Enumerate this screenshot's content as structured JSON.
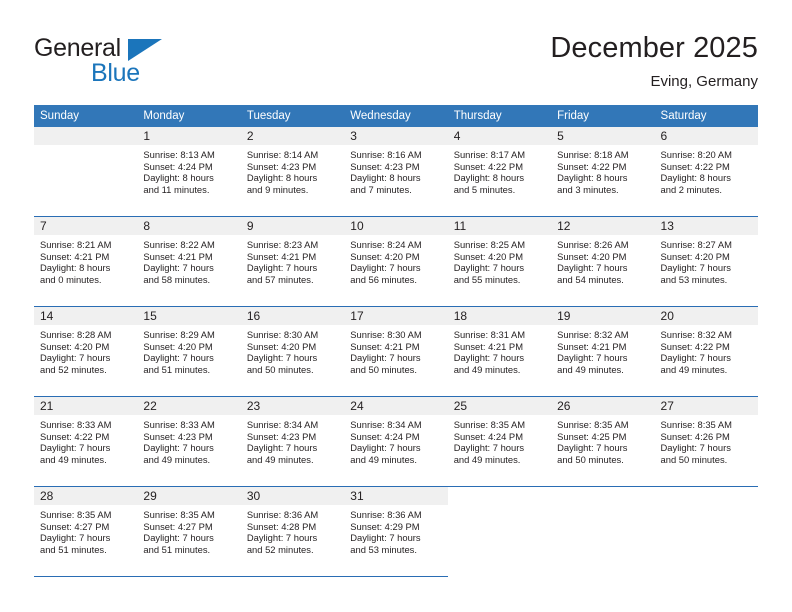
{
  "brand": {
    "name_top": "General",
    "name_bottom": "Blue",
    "colors": {
      "blue": "#1b75bb",
      "dark": "#231f20"
    }
  },
  "header": {
    "title": "December 2025",
    "subtitle": "Eving, Germany"
  },
  "calendar": {
    "header_bg": "#3277b8",
    "row_divider": "#2a6db4",
    "daynum_bg": "#f0f0f0",
    "weekday_headers": [
      "Sunday",
      "Monday",
      "Tuesday",
      "Wednesday",
      "Thursday",
      "Friday",
      "Saturday"
    ],
    "weeks": [
      [
        {
          "day": "",
          "lines": []
        },
        {
          "day": "1",
          "lines": [
            "Sunrise: 8:13 AM",
            "Sunset: 4:24 PM",
            "Daylight: 8 hours",
            "and 11 minutes."
          ]
        },
        {
          "day": "2",
          "lines": [
            "Sunrise: 8:14 AM",
            "Sunset: 4:23 PM",
            "Daylight: 8 hours",
            "and 9 minutes."
          ]
        },
        {
          "day": "3",
          "lines": [
            "Sunrise: 8:16 AM",
            "Sunset: 4:23 PM",
            "Daylight: 8 hours",
            "and 7 minutes."
          ]
        },
        {
          "day": "4",
          "lines": [
            "Sunrise: 8:17 AM",
            "Sunset: 4:22 PM",
            "Daylight: 8 hours",
            "and 5 minutes."
          ]
        },
        {
          "day": "5",
          "lines": [
            "Sunrise: 8:18 AM",
            "Sunset: 4:22 PM",
            "Daylight: 8 hours",
            "and 3 minutes."
          ]
        },
        {
          "day": "6",
          "lines": [
            "Sunrise: 8:20 AM",
            "Sunset: 4:22 PM",
            "Daylight: 8 hours",
            "and 2 minutes."
          ]
        }
      ],
      [
        {
          "day": "7",
          "lines": [
            "Sunrise: 8:21 AM",
            "Sunset: 4:21 PM",
            "Daylight: 8 hours",
            "and 0 minutes."
          ]
        },
        {
          "day": "8",
          "lines": [
            "Sunrise: 8:22 AM",
            "Sunset: 4:21 PM",
            "Daylight: 7 hours",
            "and 58 minutes."
          ]
        },
        {
          "day": "9",
          "lines": [
            "Sunrise: 8:23 AM",
            "Sunset: 4:21 PM",
            "Daylight: 7 hours",
            "and 57 minutes."
          ]
        },
        {
          "day": "10",
          "lines": [
            "Sunrise: 8:24 AM",
            "Sunset: 4:20 PM",
            "Daylight: 7 hours",
            "and 56 minutes."
          ]
        },
        {
          "day": "11",
          "lines": [
            "Sunrise: 8:25 AM",
            "Sunset: 4:20 PM",
            "Daylight: 7 hours",
            "and 55 minutes."
          ]
        },
        {
          "day": "12",
          "lines": [
            "Sunrise: 8:26 AM",
            "Sunset: 4:20 PM",
            "Daylight: 7 hours",
            "and 54 minutes."
          ]
        },
        {
          "day": "13",
          "lines": [
            "Sunrise: 8:27 AM",
            "Sunset: 4:20 PM",
            "Daylight: 7 hours",
            "and 53 minutes."
          ]
        }
      ],
      [
        {
          "day": "14",
          "lines": [
            "Sunrise: 8:28 AM",
            "Sunset: 4:20 PM",
            "Daylight: 7 hours",
            "and 52 minutes."
          ]
        },
        {
          "day": "15",
          "lines": [
            "Sunrise: 8:29 AM",
            "Sunset: 4:20 PM",
            "Daylight: 7 hours",
            "and 51 minutes."
          ]
        },
        {
          "day": "16",
          "lines": [
            "Sunrise: 8:30 AM",
            "Sunset: 4:20 PM",
            "Daylight: 7 hours",
            "and 50 minutes."
          ]
        },
        {
          "day": "17",
          "lines": [
            "Sunrise: 8:30 AM",
            "Sunset: 4:21 PM",
            "Daylight: 7 hours",
            "and 50 minutes."
          ]
        },
        {
          "day": "18",
          "lines": [
            "Sunrise: 8:31 AM",
            "Sunset: 4:21 PM",
            "Daylight: 7 hours",
            "and 49 minutes."
          ]
        },
        {
          "day": "19",
          "lines": [
            "Sunrise: 8:32 AM",
            "Sunset: 4:21 PM",
            "Daylight: 7 hours",
            "and 49 minutes."
          ]
        },
        {
          "day": "20",
          "lines": [
            "Sunrise: 8:32 AM",
            "Sunset: 4:22 PM",
            "Daylight: 7 hours",
            "and 49 minutes."
          ]
        }
      ],
      [
        {
          "day": "21",
          "lines": [
            "Sunrise: 8:33 AM",
            "Sunset: 4:22 PM",
            "Daylight: 7 hours",
            "and 49 minutes."
          ]
        },
        {
          "day": "22",
          "lines": [
            "Sunrise: 8:33 AM",
            "Sunset: 4:23 PM",
            "Daylight: 7 hours",
            "and 49 minutes."
          ]
        },
        {
          "day": "23",
          "lines": [
            "Sunrise: 8:34 AM",
            "Sunset: 4:23 PM",
            "Daylight: 7 hours",
            "and 49 minutes."
          ]
        },
        {
          "day": "24",
          "lines": [
            "Sunrise: 8:34 AM",
            "Sunset: 4:24 PM",
            "Daylight: 7 hours",
            "and 49 minutes."
          ]
        },
        {
          "day": "25",
          "lines": [
            "Sunrise: 8:35 AM",
            "Sunset: 4:24 PM",
            "Daylight: 7 hours",
            "and 49 minutes."
          ]
        },
        {
          "day": "26",
          "lines": [
            "Sunrise: 8:35 AM",
            "Sunset: 4:25 PM",
            "Daylight: 7 hours",
            "and 50 minutes."
          ]
        },
        {
          "day": "27",
          "lines": [
            "Sunrise: 8:35 AM",
            "Sunset: 4:26 PM",
            "Daylight: 7 hours",
            "and 50 minutes."
          ]
        }
      ],
      [
        {
          "day": "28",
          "lines": [
            "Sunrise: 8:35 AM",
            "Sunset: 4:27 PM",
            "Daylight: 7 hours",
            "and 51 minutes."
          ]
        },
        {
          "day": "29",
          "lines": [
            "Sunrise: 8:35 AM",
            "Sunset: 4:27 PM",
            "Daylight: 7 hours",
            "and 51 minutes."
          ]
        },
        {
          "day": "30",
          "lines": [
            "Sunrise: 8:36 AM",
            "Sunset: 4:28 PM",
            "Daylight: 7 hours",
            "and 52 minutes."
          ]
        },
        {
          "day": "31",
          "lines": [
            "Sunrise: 8:36 AM",
            "Sunset: 4:29 PM",
            "Daylight: 7 hours",
            "and 53 minutes."
          ]
        },
        {
          "day": "",
          "lines": []
        },
        {
          "day": "",
          "lines": []
        },
        {
          "day": "",
          "lines": []
        }
      ]
    ]
  }
}
